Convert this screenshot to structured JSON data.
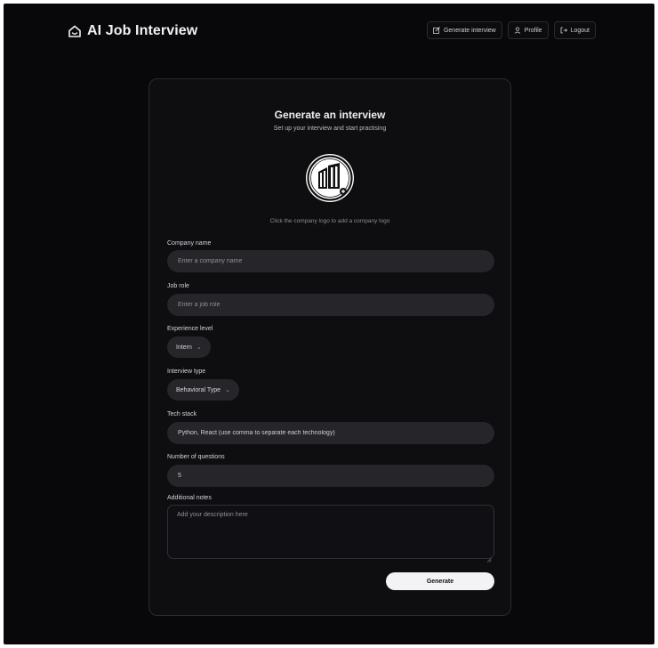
{
  "app": {
    "title": "AI Job Interview"
  },
  "nav": {
    "items": [
      {
        "label": "Generate interview",
        "icon": "edit-icon"
      },
      {
        "label": "Profile",
        "icon": "user-icon"
      },
      {
        "label": "Logout",
        "icon": "logout-icon"
      }
    ]
  },
  "card": {
    "title": "Generate an interview",
    "subtitle": "Set up your interview and start practising",
    "logo_hint": "Click the company logo to add a company logo"
  },
  "form": {
    "company_name": {
      "label": "Company name",
      "placeholder": "Enter a company name"
    },
    "job_role": {
      "label": "Job role",
      "placeholder": "Enter a job role"
    },
    "experience_level": {
      "label": "Experience level",
      "value": "Intern"
    },
    "interview_type": {
      "label": "Interview type",
      "value": "Behavioral Type"
    },
    "tech_stack": {
      "label": "Tech stack",
      "value": "Python, React (use comma to separate each technology)"
    },
    "number_of_questions": {
      "label": "Number of questions",
      "value": "5"
    },
    "additional_notes": {
      "label": "Additional notes",
      "placeholder": "Add your description here"
    },
    "submit_label": "Generate"
  },
  "colors": {
    "background": "#08080a",
    "card": "#0e0e11",
    "field": "#25252a",
    "button": "#f3f3f5"
  }
}
